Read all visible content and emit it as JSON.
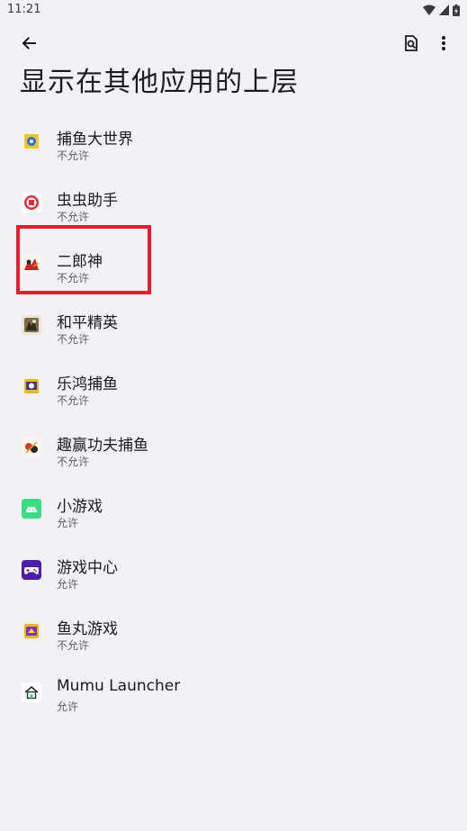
{
  "status_bar": {
    "time": "11:21"
  },
  "header": {
    "title": "显示在其他应用的上层"
  },
  "apps": [
    {
      "name": "捕鱼大世界",
      "status": "不允许",
      "icon": "fishing-world-app-icon"
    },
    {
      "name": "虫虫助手",
      "status": "不允许",
      "icon": "chongchong-assistant-app-icon"
    },
    {
      "name": "二郎神",
      "status": "不允许",
      "icon": "erlangshen-app-icon"
    },
    {
      "name": "和平精英",
      "status": "不允许",
      "icon": "peace-elite-app-icon"
    },
    {
      "name": "乐鸿捕鱼",
      "status": "不允许",
      "icon": "lehong-fishing-app-icon"
    },
    {
      "name": "趣赢功夫捕鱼",
      "status": "不允许",
      "icon": "kungfu-fishing-app-icon"
    },
    {
      "name": "小游戏",
      "status": "允许",
      "icon": "android-app-icon"
    },
    {
      "name": "游戏中心",
      "status": "允许",
      "icon": "gamepad-app-icon"
    },
    {
      "name": "鱼丸游戏",
      "status": "不允许",
      "icon": "yuwan-game-app-icon"
    },
    {
      "name": "Mumu Launcher",
      "status": "允许",
      "icon": "home-launcher-app-icon"
    }
  ],
  "colors": {
    "background": "#f3f1f6",
    "highlight": "#e0202c",
    "android_green": "#3ddc84",
    "game_center_purple": "#4b1fa8"
  }
}
